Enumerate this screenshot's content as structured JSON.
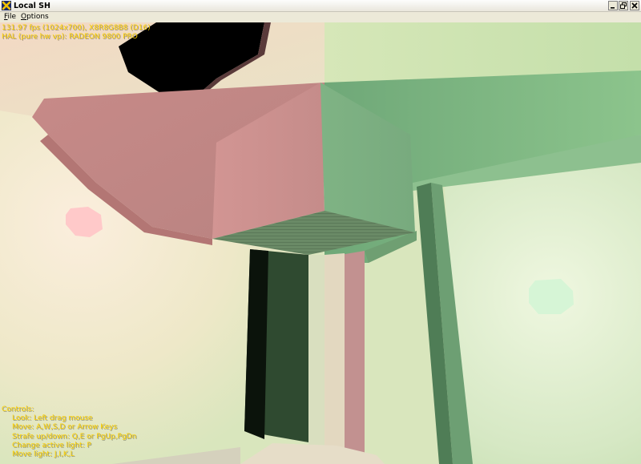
{
  "window": {
    "title": "Local SH",
    "icon": "directx-x-icon",
    "controls": [
      "minimize",
      "restore",
      "close"
    ]
  },
  "menu": {
    "file_label": "File",
    "file_underline": "F",
    "file_rest": "ile",
    "options_label": "Options",
    "options_underline": "O",
    "options_rest": "ptions"
  },
  "hud": {
    "stats_line1": "131.97 fps (1024x700), X8R8G8B8 (D16)",
    "stats_line2": "HAL (pure hw vp): RADEON 9800 PRO",
    "controls_header": "Controls:",
    "controls": [
      "Look: Left drag mouse",
      "Move: A,W,S,D or Arrow Keys",
      "Strafe up/down: Q,E or PgUp,PgDn",
      "Change active light: P",
      "Move light: J,I,K,L"
    ]
  },
  "colors": {
    "hud_text": "#ffd200",
    "pink_block": "#c98888",
    "green_block": "#7fb482",
    "wall_light": "#f0f0d6"
  }
}
